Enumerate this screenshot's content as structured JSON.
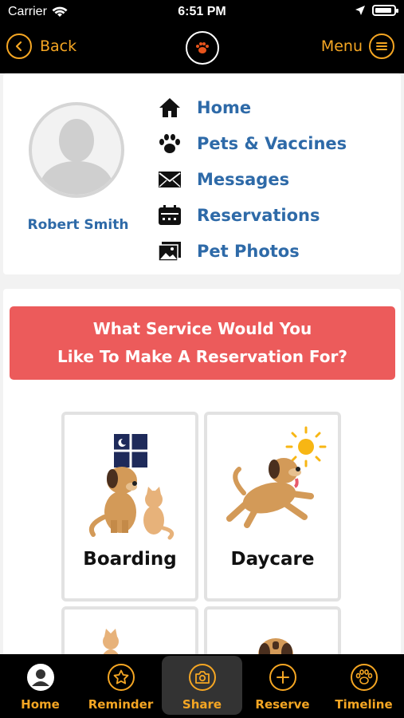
{
  "status_bar": {
    "carrier": "Carrier",
    "time": "6:51 PM",
    "battery_level": 0.9
  },
  "nav": {
    "back_label": "Back",
    "menu_label": "Menu",
    "logo_icon": "paw-logo"
  },
  "profile": {
    "name": "Robert Smith",
    "menu": [
      {
        "label": "Home",
        "icon": "house-icon"
      },
      {
        "label": "Pets & Vaccines",
        "icon": "paw-icon"
      },
      {
        "label": "Messages",
        "icon": "envelope-icon"
      },
      {
        "label": "Reservations",
        "icon": "calendar-icon"
      },
      {
        "label": "Pet Photos",
        "icon": "photos-icon"
      }
    ]
  },
  "service": {
    "prompt_line1": "What Service Would You",
    "prompt_line2": "Like To Make A Reservation For?",
    "tiles": [
      {
        "label": "Boarding"
      },
      {
        "label": "Daycare"
      },
      {
        "label": ""
      },
      {
        "label": ""
      }
    ]
  },
  "tabs": [
    {
      "label": "Home",
      "icon": "avatar-icon"
    },
    {
      "label": "Reminder",
      "icon": "star-icon"
    },
    {
      "label": "Share",
      "icon": "camera-icon",
      "active": true
    },
    {
      "label": "Reserve",
      "icon": "plus-icon"
    },
    {
      "label": "Timeline",
      "icon": "paw-icon"
    }
  ],
  "colors": {
    "accent": "#f5a623",
    "link": "#2e6aa8",
    "banner": "#ec5b5b",
    "bar": "#000000"
  }
}
